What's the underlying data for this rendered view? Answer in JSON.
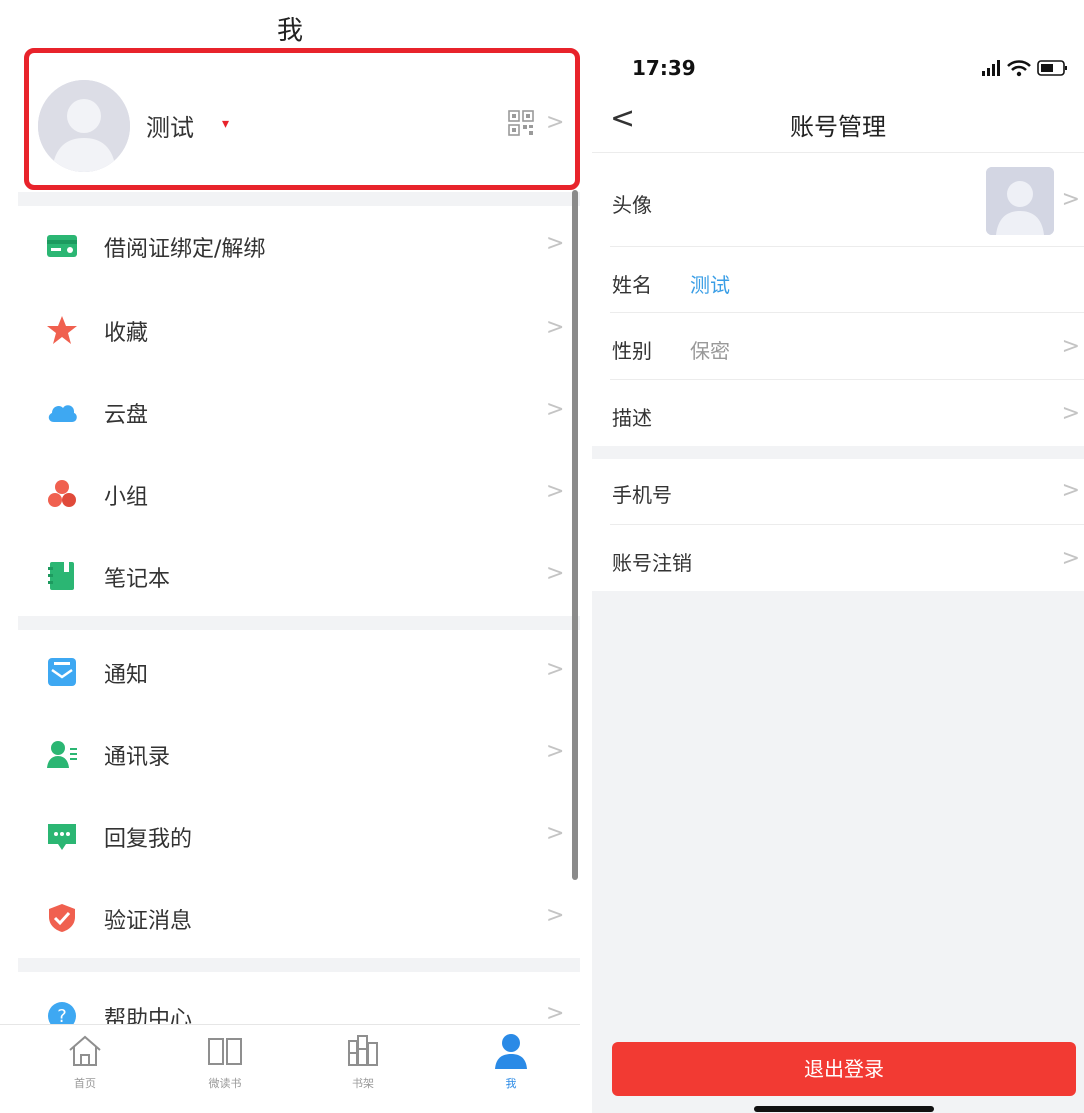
{
  "left": {
    "title": "我",
    "profile": {
      "name": "测试",
      "gender_mark": "▾",
      "qr_icon": "qr-code-icon",
      "chevron": ">"
    },
    "highlight_color": "#e8232b",
    "groups": [
      [
        {
          "label": "借阅证绑定/解绑",
          "icon": "library-card-icon",
          "color": "#2bb673"
        },
        {
          "label": "收藏",
          "icon": "star-icon",
          "color": "#f0604f"
        },
        {
          "label": "云盘",
          "icon": "cloud-icon",
          "color": "#3ea8f2"
        },
        {
          "label": "小组",
          "icon": "group-icon",
          "color": "#f0604f"
        },
        {
          "label": "笔记本",
          "icon": "notebook-icon",
          "color": "#2bb673"
        }
      ],
      [
        {
          "label": "通知",
          "icon": "notification-mail-icon",
          "color": "#3ea8f2"
        },
        {
          "label": "通讯录",
          "icon": "contacts-icon",
          "color": "#2bb673"
        },
        {
          "label": "回复我的",
          "icon": "chat-bubble-icon",
          "color": "#2bb673"
        },
        {
          "label": "验证消息",
          "icon": "shield-check-icon",
          "color": "#f0604f"
        }
      ],
      [
        {
          "label": "帮助中心",
          "icon": "help-icon",
          "color": "#3ea8f2"
        }
      ]
    ],
    "tabbar": [
      {
        "label": "首页",
        "icon": "home-icon",
        "active": false
      },
      {
        "label": "微读书",
        "icon": "open-book-icon",
        "active": false
      },
      {
        "label": "书架",
        "icon": "bookshelf-icon",
        "active": false
      },
      {
        "label": "我",
        "icon": "person-icon",
        "active": true
      }
    ]
  },
  "right": {
    "status": {
      "time": "17:39"
    },
    "nav": {
      "back": "<",
      "title": "账号管理"
    },
    "rows": {
      "avatar": {
        "label": "头像"
      },
      "name": {
        "label": "姓名",
        "value": "测试",
        "value_color": "#3a9ee6"
      },
      "gender": {
        "label": "性别",
        "value": "保密",
        "value_color": "#999999"
      },
      "description": {
        "label": "描述"
      },
      "phone": {
        "label": "手机号"
      },
      "cancel_account": {
        "label": "账号注销"
      }
    },
    "logout_label": "退出登录",
    "logout_color": "#f23a33"
  }
}
